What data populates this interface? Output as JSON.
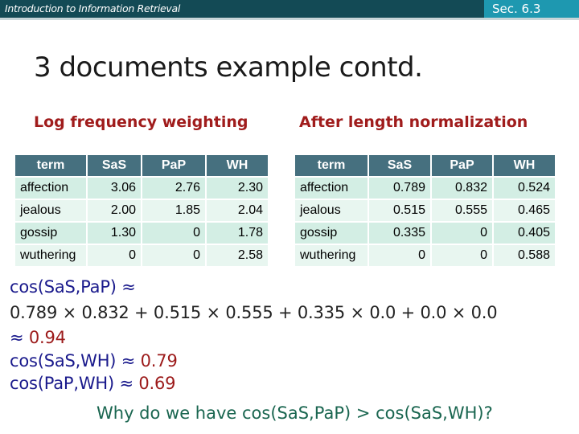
{
  "header": {
    "course": "Introduction to Information Retrieval",
    "section": "Sec. 6.3"
  },
  "slide_title": "3 documents example contd.",
  "left_table": {
    "heading": "Log frequency weighting",
    "columns": [
      "term",
      "SaS",
      "PaP",
      "WH"
    ],
    "rows": [
      [
        "affection",
        "3.06",
        "2.76",
        "2.30"
      ],
      [
        "jealous",
        "2.00",
        "1.85",
        "2.04"
      ],
      [
        "gossip",
        "1.30",
        "0",
        "1.78"
      ],
      [
        "wuthering",
        "0",
        "0",
        "2.58"
      ]
    ]
  },
  "right_table": {
    "heading": "After length normalization",
    "columns": [
      "term",
      "SaS",
      "PaP",
      "WH"
    ],
    "rows": [
      [
        "affection",
        "0.789",
        "0.832",
        "0.524"
      ],
      [
        "jealous",
        "0.515",
        "0.555",
        "0.465"
      ],
      [
        "gossip",
        "0.335",
        "0",
        "0.405"
      ],
      [
        "wuthering",
        "0",
        "0",
        "0.588"
      ]
    ]
  },
  "math": {
    "line1": "cos(SaS,PaP) ≈",
    "line2": "0.789 × 0.832 + 0.515 × 0.555 + 0.335 × 0.0 + 0.0 × 0.0",
    "line3_approx": "≈ ",
    "line3_value": "0.94",
    "line4_label": "cos(SaS,WH) ≈ ",
    "line4_value": "0.79",
    "line5_label": "cos(PaP,WH) ≈ ",
    "line5_value": "0.69",
    "question": "Why do we have cos(SaS,PaP) > cos(SaS,WH)?"
  }
}
